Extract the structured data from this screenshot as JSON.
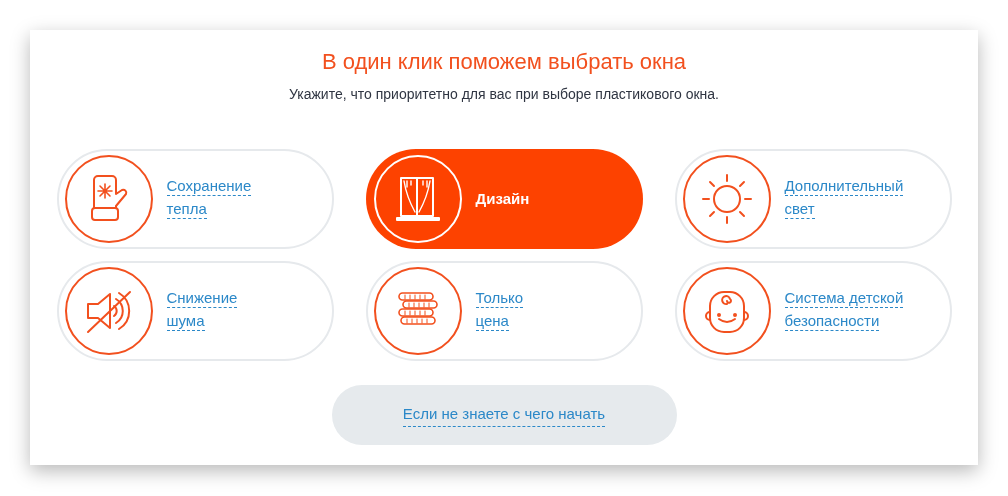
{
  "title": "В один клик поможем выбрать окна",
  "subtitle": "Укажите, что приоритетно для вас при выборе пластикового окна.",
  "options": [
    {
      "kind": "mitten",
      "lines": [
        "Сохранение",
        "тепла"
      ],
      "selected": false
    },
    {
      "kind": "window",
      "lines": [
        "Дизайн"
      ],
      "selected": true
    },
    {
      "kind": "sun",
      "lines": [
        "Дополнительный",
        "свет"
      ],
      "selected": false
    },
    {
      "kind": "mute",
      "lines": [
        "Снижение",
        "шума"
      ],
      "selected": false
    },
    {
      "kind": "coins",
      "lines": [
        "Только",
        "цена"
      ],
      "selected": false
    },
    {
      "kind": "baby",
      "lines": [
        "Система детской",
        "безопасности"
      ],
      "selected": false
    }
  ],
  "help_button": "Если не знаете с чего начать"
}
